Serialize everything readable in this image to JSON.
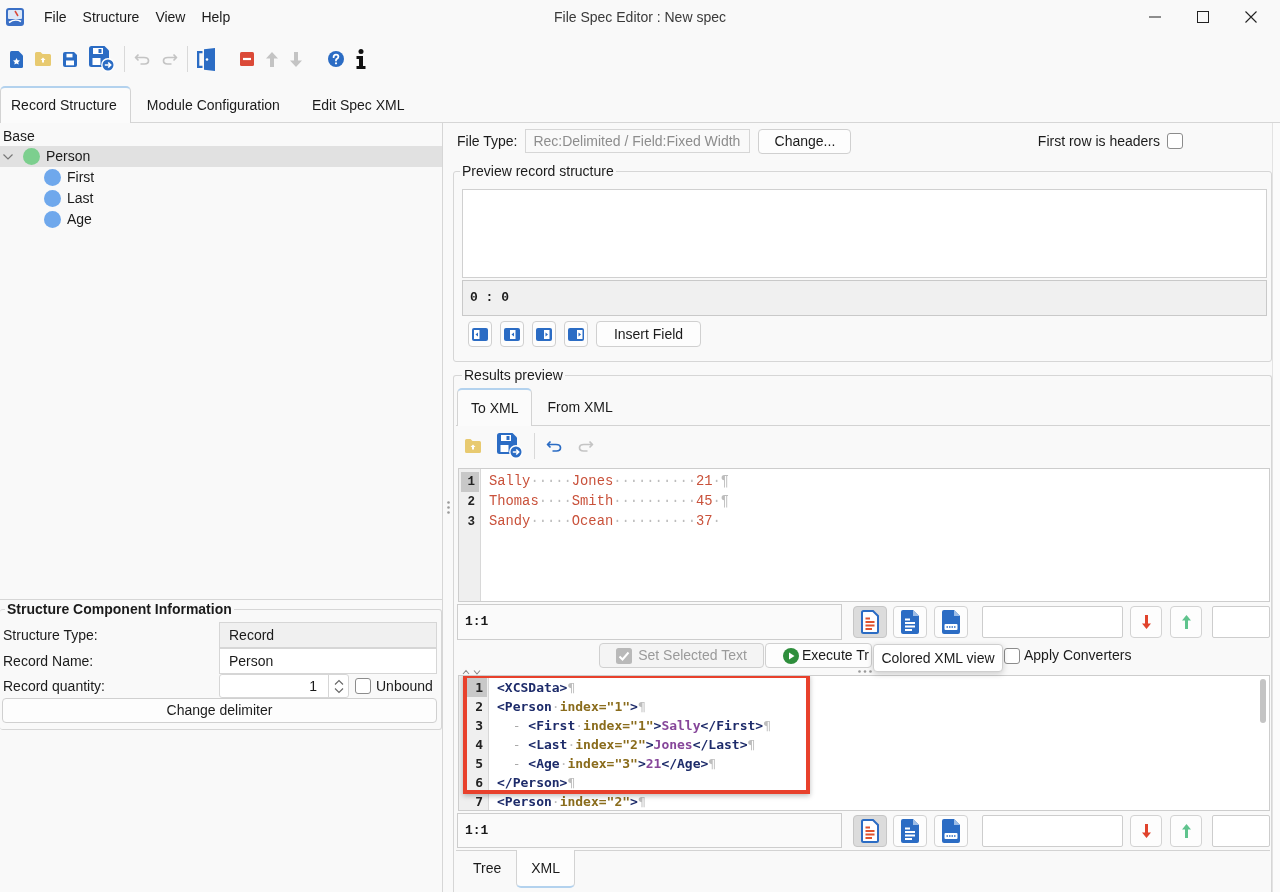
{
  "window": {
    "title": "File Spec Editor : New spec"
  },
  "menu": [
    "File",
    "Structure",
    "View",
    "Help"
  ],
  "toolbar": [
    {
      "kind": "new",
      "disabled": false
    },
    {
      "kind": "open",
      "disabled": false
    },
    {
      "kind": "save",
      "disabled": false
    },
    {
      "kind": "save-as",
      "disabled": false
    },
    {
      "kind": "separator"
    },
    {
      "kind": "undo",
      "disabled": true
    },
    {
      "kind": "redo",
      "disabled": true
    },
    {
      "kind": "separator"
    },
    {
      "kind": "exit",
      "disabled": false
    },
    {
      "kind": "remove",
      "disabled": false
    },
    {
      "kind": "up",
      "disabled": true
    },
    {
      "kind": "down",
      "disabled": true
    },
    {
      "kind": "help",
      "disabled": false
    },
    {
      "kind": "about",
      "disabled": false
    }
  ],
  "tabs": [
    {
      "label": "Record Structure",
      "selected": true
    },
    {
      "label": "Module Configuration",
      "selected": false
    },
    {
      "label": "Edit Spec XML",
      "selected": false
    }
  ],
  "structure_tree": {
    "header": "Base",
    "nodes": [
      {
        "label": "Person",
        "color": "#7ccf8e",
        "selected": true,
        "expanded": true,
        "children": [
          {
            "label": "First",
            "color": "#6fa8ec",
            "selected": false
          },
          {
            "label": "Last",
            "color": "#6fa8ec",
            "selected": false
          },
          {
            "label": "Age",
            "color": "#6fa8ec",
            "selected": false
          }
        ]
      }
    ]
  },
  "component_info": {
    "title": "Structure Component Information",
    "fields": [
      {
        "label": "Structure Type:",
        "value": "Record",
        "disabled": true
      },
      {
        "label": "Record Name:",
        "value": "Person",
        "disabled": false
      }
    ],
    "quantity": {
      "label": "Record quantity:",
      "value": "1"
    },
    "unbound": {
      "label": "Unbound",
      "checked": false
    },
    "button": "Change delimiter"
  },
  "file_type": {
    "label": "File Type:",
    "field": {
      "value": "Rec:Delimited / Field:Fixed Width",
      "disabled": true
    },
    "button": "Change...",
    "headers_checkbox": {
      "label": "First row is headers",
      "checked": false
    }
  },
  "preview_record_structure": {
    "title": "Preview record structure",
    "position": "0 : 0",
    "button": "Insert Field"
  },
  "results_preview": {
    "title": "Results preview",
    "tabs": [
      {
        "label": "To XML",
        "selected": true
      },
      {
        "label": "From XML",
        "selected": false
      }
    ],
    "toolbar": [
      {
        "kind": "open",
        "disabled": false
      },
      {
        "kind": "save-as",
        "disabled": false
      },
      {
        "kind": "separator"
      },
      {
        "kind": "undo",
        "disabled": false
      },
      {
        "kind": "redo",
        "disabled": true
      }
    ],
    "input_editor": {
      "lines": [
        {
          "number": "1",
          "current": true,
          "tokens": [
            {
              "kind": "data",
              "text": "Sally"
            },
            {
              "kind": "space",
              "text": "·····"
            },
            {
              "kind": "data",
              "text": "Jones"
            },
            {
              "kind": "space",
              "text": "··········"
            },
            {
              "kind": "data",
              "text": "21"
            },
            {
              "kind": "space",
              "text": "·"
            },
            {
              "kind": "eol",
              "text": "¶"
            }
          ]
        },
        {
          "number": "2",
          "current": false,
          "tokens": [
            {
              "kind": "data",
              "text": "Thomas"
            },
            {
              "kind": "space",
              "text": "····"
            },
            {
              "kind": "data",
              "text": "Smith"
            },
            {
              "kind": "space",
              "text": "··········"
            },
            {
              "kind": "data",
              "text": "45"
            },
            {
              "kind": "space",
              "text": "·"
            },
            {
              "kind": "eol",
              "text": "¶"
            }
          ]
        },
        {
          "number": "3",
          "current": false,
          "tokens": [
            {
              "kind": "data",
              "text": "Sandy"
            },
            {
              "kind": "space",
              "text": "·····"
            },
            {
              "kind": "data",
              "text": "Ocean"
            },
            {
              "kind": "space",
              "text": "··········"
            },
            {
              "kind": "data",
              "text": "37"
            },
            {
              "kind": "space",
              "text": "·"
            }
          ]
        }
      ],
      "position": "1:1",
      "views": [
        {
          "kind": "colored",
          "selected": true
        },
        {
          "kind": "plain",
          "selected": false
        },
        {
          "kind": "html",
          "selected": false
        }
      ]
    },
    "actions": {
      "set_selected_text": {
        "label": "Set Selected Text",
        "disabled": true
      },
      "execute": {
        "label": "Execute Tr"
      },
      "apply_converters": {
        "label": "Apply Converters",
        "checked": false
      }
    },
    "tooltip": "Colored XML view",
    "output_editor": {
      "lines": [
        {
          "number": "1",
          "current": true,
          "tokens": [
            {
              "kind": "tag",
              "text": "<XCSData>"
            },
            {
              "kind": "eol",
              "text": "¶"
            }
          ]
        },
        {
          "number": "2",
          "current": false,
          "tokens": [
            {
              "kind": "tag",
              "text": "<Person"
            },
            {
              "kind": "space",
              "text": "·"
            },
            {
              "kind": "attr",
              "text": "index=\"1\""
            },
            {
              "kind": "tag",
              "text": ">"
            },
            {
              "kind": "eol",
              "text": "¶"
            }
          ]
        },
        {
          "number": "3",
          "current": false,
          "tokens": [
            {
              "kind": "indent",
              "text": "  - "
            },
            {
              "kind": "tag",
              "text": "<First"
            },
            {
              "kind": "space",
              "text": "·"
            },
            {
              "kind": "attr",
              "text": "index=\"1\""
            },
            {
              "kind": "tag",
              "text": ">"
            },
            {
              "kind": "content",
              "text": "Sally"
            },
            {
              "kind": "tag",
              "text": "</First>"
            },
            {
              "kind": "eol",
              "text": "¶"
            }
          ]
        },
        {
          "number": "4",
          "current": false,
          "tokens": [
            {
              "kind": "indent",
              "text": "  - "
            },
            {
              "kind": "tag",
              "text": "<Last"
            },
            {
              "kind": "space",
              "text": "·"
            },
            {
              "kind": "attr",
              "text": "index=\"2\""
            },
            {
              "kind": "tag",
              "text": ">"
            },
            {
              "kind": "content",
              "text": "Jones"
            },
            {
              "kind": "tag",
              "text": "</Last>"
            },
            {
              "kind": "eol",
              "text": "¶"
            }
          ]
        },
        {
          "number": "5",
          "current": false,
          "tokens": [
            {
              "kind": "indent",
              "text": "  - "
            },
            {
              "kind": "tag",
              "text": "<Age"
            },
            {
              "kind": "space",
              "text": "·"
            },
            {
              "kind": "attr",
              "text": "index=\"3\""
            },
            {
              "kind": "tag",
              "text": ">"
            },
            {
              "kind": "content",
              "text": "21"
            },
            {
              "kind": "tag",
              "text": "</Age>"
            },
            {
              "kind": "eol",
              "text": "¶"
            }
          ]
        },
        {
          "number": "6",
          "current": false,
          "tokens": [
            {
              "kind": "tag",
              "text": "</Person>"
            },
            {
              "kind": "eol",
              "text": "¶"
            }
          ]
        },
        {
          "number": "7",
          "current": false,
          "tokens": [
            {
              "kind": "tag",
              "text": "<Person"
            },
            {
              "kind": "space",
              "text": "·"
            },
            {
              "kind": "attr",
              "text": "index=\"2\""
            },
            {
              "kind": "tag",
              "text": ">"
            },
            {
              "kind": "eol",
              "text": "¶"
            }
          ]
        }
      ],
      "position": "1:1",
      "views": [
        {
          "kind": "colored",
          "selected": true
        },
        {
          "kind": "plain",
          "selected": false
        },
        {
          "kind": "html",
          "selected": false
        }
      ]
    },
    "output_tabs": [
      {
        "label": "Tree",
        "selected": false
      },
      {
        "label": "XML",
        "selected": true
      }
    ]
  }
}
